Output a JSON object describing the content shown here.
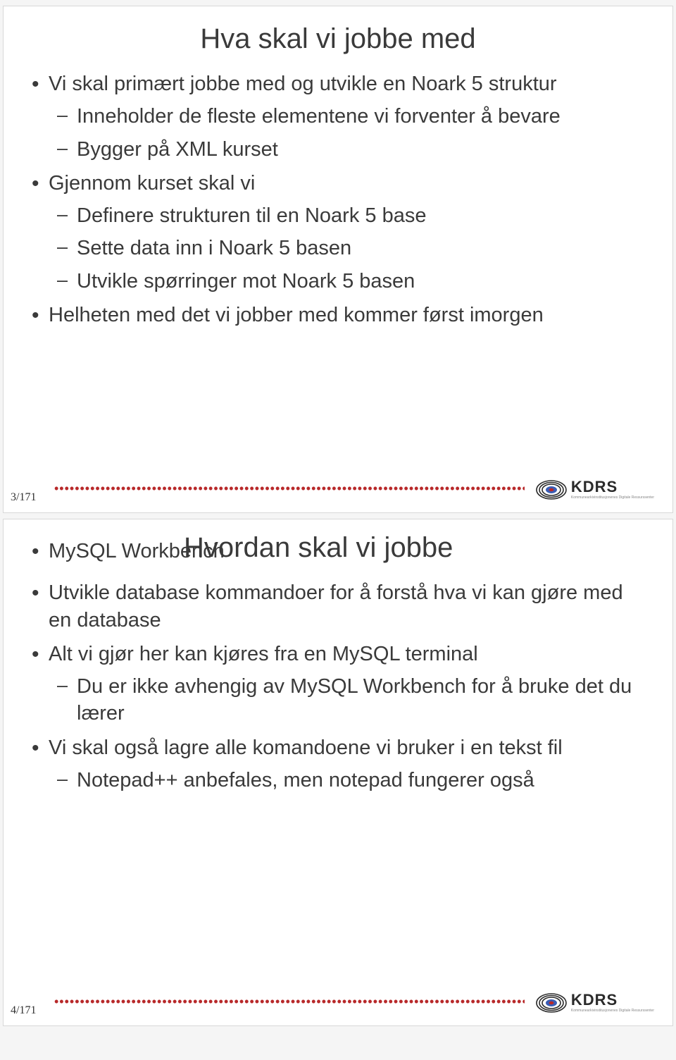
{
  "slide1": {
    "pagenum": "3/171",
    "title": "Hva skal vi jobbe med",
    "items": [
      {
        "text": "Vi skal primært jobbe med og utvikle en Noark 5 struktur",
        "sub": [
          "Inneholder de fleste elementene vi forventer å bevare",
          "Bygger på XML kurset"
        ]
      },
      {
        "text": "Gjennom kurset skal vi",
        "sub": [
          "Definere strukturen til en Noark 5 base",
          "Sette data inn i Noark 5 basen",
          "Utvikle spørringer mot Noark 5 basen"
        ]
      },
      {
        "text": "Helheten med det vi jobber med kommer først imorgen",
        "sub": []
      }
    ]
  },
  "slide2": {
    "pagenum": "4/171",
    "title": "Hvordan skal vi jobbe",
    "items": [
      {
        "text": "MySQL Workbench",
        "sub": []
      },
      {
        "text": "Utvikle database kommandoer for å forstå hva vi kan gjøre med en database",
        "sub": []
      },
      {
        "text": "Alt vi gjør her kan kjøres fra en MySQL terminal",
        "sub": [
          "Du er ikke avhengig av MySQL Workbench for å bruke det du lærer"
        ]
      },
      {
        "text": "Vi skal også lagre alle komandoene vi bruker i en tekst fil",
        "sub": [
          "Notepad++ anbefales, men notepad fungerer også"
        ]
      }
    ]
  },
  "logo": {
    "text": "KDRS"
  }
}
